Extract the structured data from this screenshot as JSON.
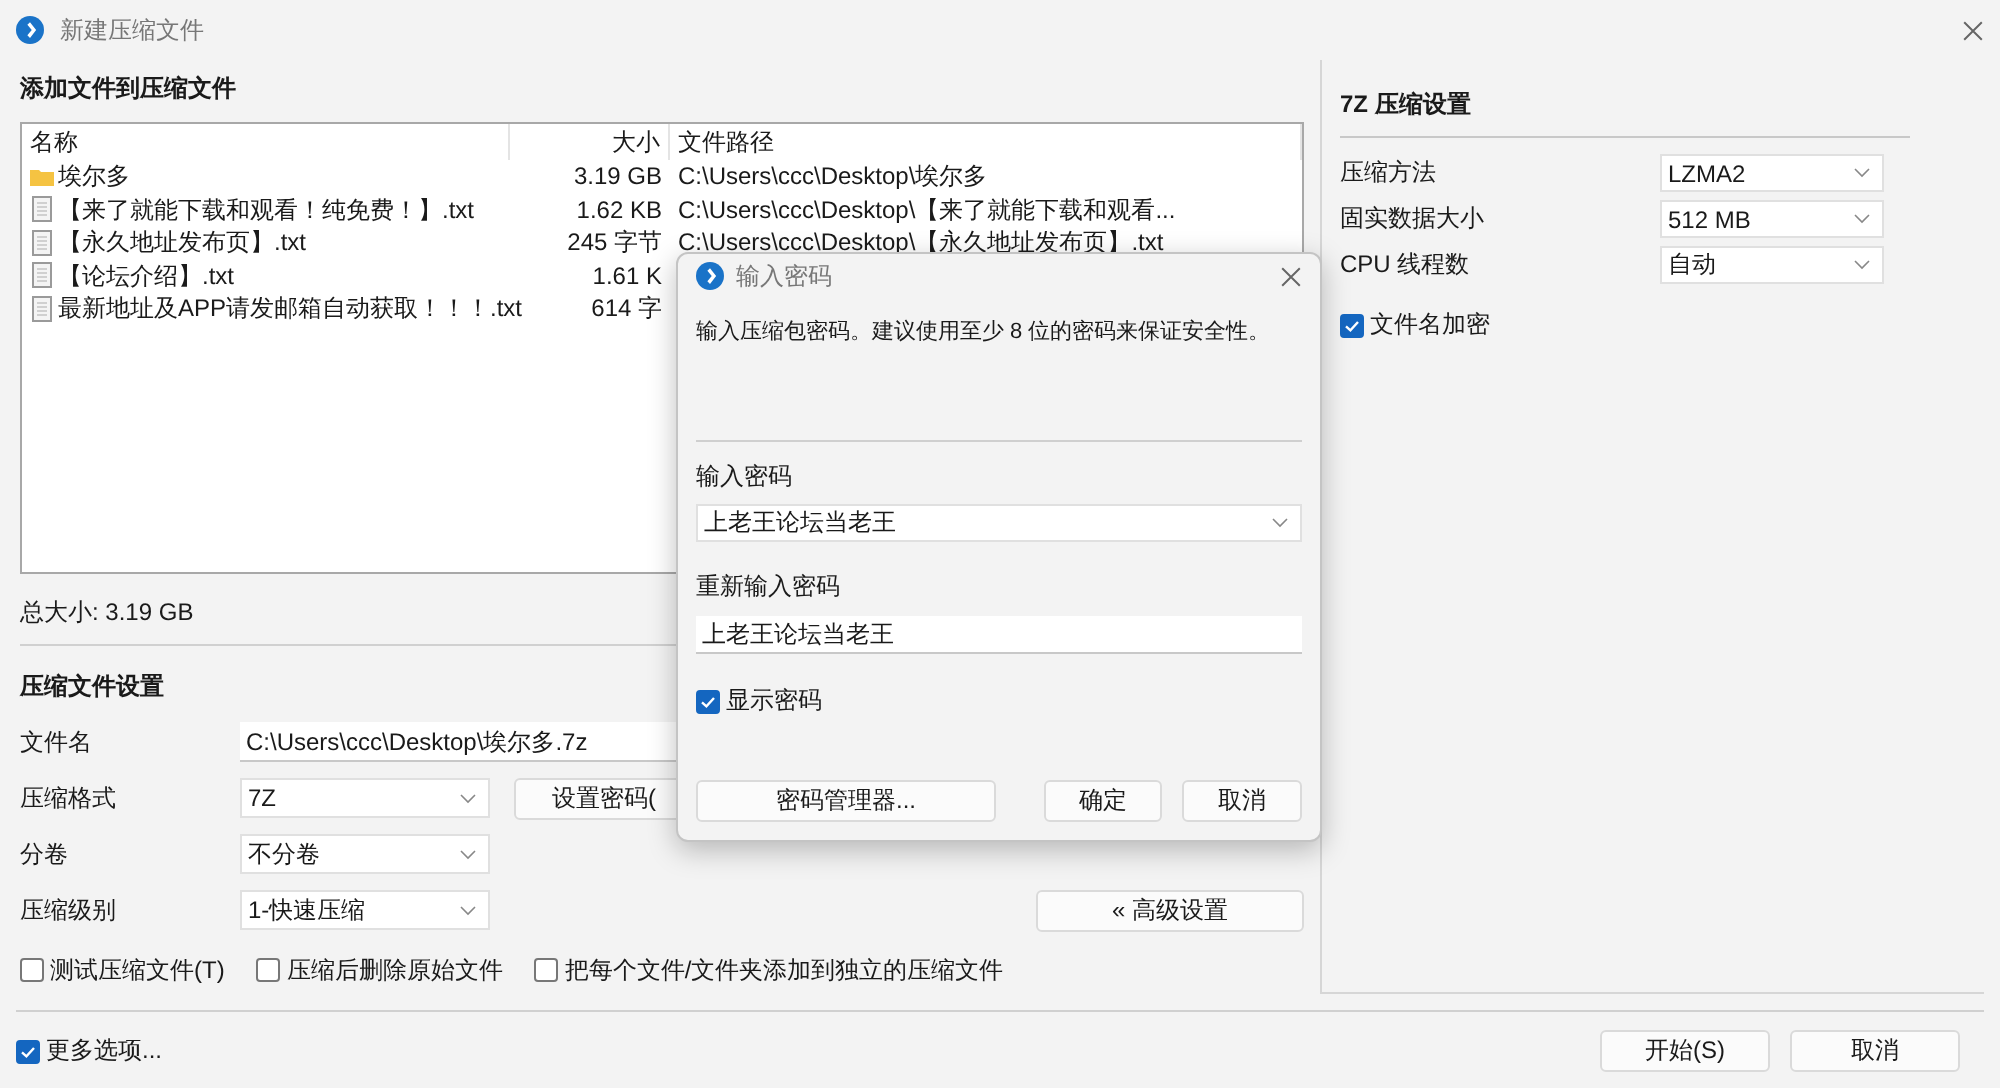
{
  "window": {
    "title": "新建压缩文件"
  },
  "files": {
    "title": "添加文件到压缩文件",
    "columns": [
      "名称",
      "大小",
      "文件路径"
    ],
    "rows": [
      {
        "kind": "folder",
        "name": "埃尔多",
        "size": "3.19 GB",
        "path": "C:\\Users\\ccc\\Desktop\\埃尔多"
      },
      {
        "kind": "file",
        "name": "【来了就能下载和观看！纯免费！】.txt",
        "size": "1.62 KB",
        "path": "C:\\Users\\ccc\\Desktop\\【来了就能下载和观看..."
      },
      {
        "kind": "file",
        "name": "【永久地址发布页】.txt",
        "size": "245 字节",
        "path": "C:\\Users\\ccc\\Desktop\\【永久地址发布页】.txt"
      },
      {
        "kind": "file",
        "name": "【论坛介绍】.txt",
        "size": "1.61 K"
      },
      {
        "kind": "file",
        "name": "最新地址及APP请发邮箱自动获取！！！.txt",
        "size": "614 字"
      }
    ],
    "total": "总大小: 3.19 GB"
  },
  "archive_settings": {
    "title": "压缩文件设置",
    "fields": [
      {
        "kind": "text",
        "label": "文件名",
        "value": "C:\\Users\\ccc\\Desktop\\埃尔多.7z"
      },
      {
        "kind": "combo",
        "label": "压缩格式",
        "value": "7Z"
      },
      {
        "kind": "combo",
        "label": "分卷",
        "value": "不分卷"
      },
      {
        "kind": "combo",
        "label": "压缩级别",
        "value": "1-快速压缩"
      }
    ],
    "set_password_button": "设置密码(",
    "advanced_button": "« 高级设置",
    "options": [
      {
        "label": "测试压缩文件(T)",
        "checked": false
      },
      {
        "label": "压缩后删除原始文件",
        "checked": false
      },
      {
        "label": "把每个文件/文件夹添加到独立的压缩文件",
        "checked": false
      }
    ]
  },
  "more_options": {
    "label": "更多选项...",
    "checked": true
  },
  "buttons": [
    "开始(S)",
    "取消"
  ],
  "method_panel": {
    "title": "7Z 压缩设置",
    "fields": [
      {
        "label": "压缩方法",
        "value": "LZMA2"
      },
      {
        "label": "固实数据大小",
        "value": "512 MB"
      },
      {
        "label": "CPU 线程数",
        "value": "自动"
      }
    ],
    "encrypt_names": {
      "label": "文件名加密",
      "checked": true
    }
  },
  "password_dialog": {
    "title": "输入密码",
    "message": "输入压缩包密码。建议使用至少 8 位的密码来保证安全性。",
    "password_label": "输入密码",
    "password_value": "上老王论坛当老王",
    "confirm_label": "重新输入密码",
    "confirm_value": "上老王论坛当老王",
    "show_password": {
      "label": "显示密码",
      "checked": true
    },
    "buttons": [
      "密码管理器...",
      "确定",
      "取消"
    ]
  }
}
